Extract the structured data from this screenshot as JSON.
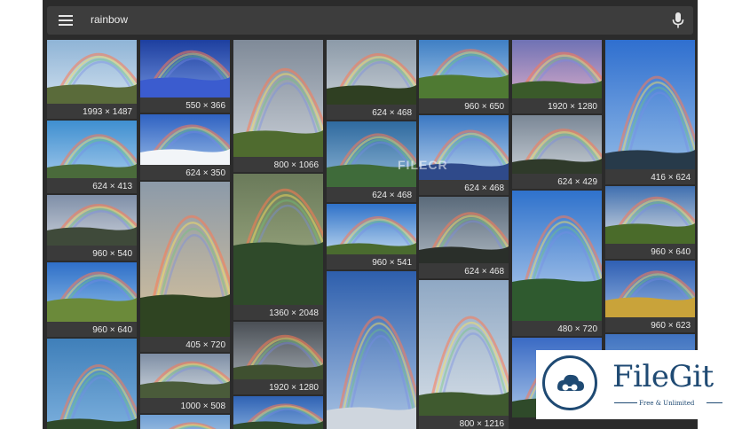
{
  "search": {
    "query": "rainbow"
  },
  "icons": {
    "menu": "hamburger-menu-icon",
    "mic": "microphone-icon"
  },
  "watermark": "FILECR",
  "badge": {
    "name": "FileGit",
    "tagline": "Free & Unlimited"
  },
  "columns": [
    [
      {
        "size": "1993 × 1487",
        "h": 89,
        "sky": [
          "#8fb4d6",
          "#cfdfee"
        ],
        "ground": "#5a6b3a",
        "gh": 0.25
      },
      {
        "size": "624 × 413",
        "h": 82,
        "sky": [
          "#3f8fd0",
          "#9fc7ea"
        ],
        "ground": "#4a6b3b",
        "gh": 0.18
      },
      {
        "size": "960 × 540",
        "h": 74,
        "sky": [
          "#7f8fa8",
          "#c9cfd9"
        ],
        "ground": "#3f4a3a",
        "gh": 0.3
      },
      {
        "size": "960 × 640",
        "h": 84,
        "sky": [
          "#2f6fc8",
          "#8fbfe8"
        ],
        "ground": "#6b8a3a",
        "gh": 0.35
      },
      {
        "size": "",
        "h": 110,
        "sky": [
          "#3f7fb9",
          "#7fb2df"
        ],
        "ground": "#2f4a2a",
        "gh": 0.15
      }
    ],
    [
      {
        "size": "550 × 366",
        "h": 82,
        "sky": [
          "#1d3f9f",
          "#6e8fdc"
        ],
        "ground": "#3b5ccf",
        "gh": 0.3
      },
      {
        "size": "624 × 350",
        "h": 74,
        "sky": [
          "#2f62c2",
          "#8fb3e3"
        ],
        "ground": "#f2f5f8",
        "gh": 0.25
      },
      {
        "size": "405 × 720",
        "h": 192,
        "sky": [
          "#8c9aa9",
          "#d8c29b"
        ],
        "ground": "#2f4422",
        "gh": 0.25
      },
      {
        "size": "1000 × 508",
        "h": 67,
        "sky": [
          "#7e8ea4",
          "#d0d8e0"
        ],
        "ground": "#4a5b3a",
        "gh": 0.3
      },
      {
        "size": "",
        "h": 40,
        "sky": [
          "#6f9fd4",
          "#bcd2ea"
        ],
        "ground": "#dfe6ee",
        "gh": 0.2
      }
    ],
    [
      {
        "size": "800 × 1066",
        "h": 149,
        "sky": [
          "#7f8a98",
          "#c8ced6"
        ],
        "ground": "#4f6b2f",
        "gh": 0.2
      },
      {
        "size": "1360 × 2048",
        "h": 165,
        "sky": [
          "#6a7a5a",
          "#a8b48a"
        ],
        "ground": "#2f4a2a",
        "gh": 0.45
      },
      {
        "size": "1920 × 1280",
        "h": 82,
        "sky": [
          "#4a4f55",
          "#9aa1a8"
        ],
        "ground": "#3f5030",
        "gh": 0.2
      },
      {
        "size": "",
        "h": 40,
        "sky": [
          "#2f62b4",
          "#7fa8da"
        ],
        "ground": "#304a2a",
        "gh": 0.2
      }
    ],
    [
      {
        "size": "624 × 468",
        "h": 90,
        "sky": [
          "#8c9aa8",
          "#c4ccd4"
        ],
        "ground": "#2f3f22",
        "gh": 0.25
      },
      {
        "size": "624 × 468",
        "h": 91,
        "sky": [
          "#2f6a9f",
          "#8fb6d6"
        ],
        "ground": "#3f6b3a",
        "gh": 0.3
      },
      {
        "size": "960 × 541",
        "h": 74,
        "sky": [
          "#2f72c9",
          "#bcd6ee"
        ],
        "ground": "#4a6b2f",
        "gh": 0.15
      },
      {
        "size": "",
        "h": 178,
        "sky": [
          "#2e5fad",
          "#a9c3e3"
        ],
        "ground": "#cfd6de",
        "gh": 0.12
      }
    ],
    [
      {
        "size": "960 × 650",
        "h": 83,
        "sky": [
          "#3f7fc4",
          "#a7c8e8"
        ],
        "ground": "#4f7a33",
        "gh": 0.35
      },
      {
        "size": "624 × 468",
        "h": 90,
        "sky": [
          "#3b78c3",
          "#b8d2ec"
        ],
        "ground": "#2f4a8a",
        "gh": 0.2
      },
      {
        "size": "624 × 468",
        "h": 92,
        "sky": [
          "#5a6a7a",
          "#aab4be"
        ],
        "ground": "#2a2f2a",
        "gh": 0.2
      },
      {
        "size": "800 × 1216",
        "h": 170,
        "sky": [
          "#8fa8c4",
          "#d4dde6"
        ],
        "ground": "#3f5a2f",
        "gh": 0.15
      }
    ],
    [
      {
        "size": "1920 × 1280",
        "h": 83,
        "sky": [
          "#6f72b4",
          "#d2a8c8"
        ],
        "ground": "#3a5a2a",
        "gh": 0.25
      },
      {
        "size": "624 × 429",
        "h": 83,
        "sky": [
          "#7a8796",
          "#c5ccd3"
        ],
        "ground": "#2f3a2a",
        "gh": 0.2
      },
      {
        "size": "480 × 720",
        "h": 164,
        "sky": [
          "#2f72cc",
          "#bcd3ee"
        ],
        "ground": "#2f5a2f",
        "gh": 0.3
      },
      {
        "size": "",
        "h": 90,
        "sky": [
          "#3a6ac4",
          "#a8c4e8"
        ],
        "ground": "#2f4a2a",
        "gh": 0.2
      }
    ],
    [
      {
        "size": "416 × 624",
        "h": 163,
        "sky": [
          "#2f6fcf",
          "#8fb8e6"
        ],
        "ground": "#273a4a",
        "gh": 0.12
      },
      {
        "size": "960 × 640",
        "h": 82,
        "sky": [
          "#3f6fb0",
          "#d8dde2"
        ],
        "ground": "#4a6b2a",
        "gh": 0.3
      },
      {
        "size": "960 × 623",
        "h": 81,
        "sky": [
          "#2f5fb4",
          "#8fb0dc"
        ],
        "ground": "#c9a33a",
        "gh": 0.3
      },
      {
        "size": "",
        "h": 90,
        "sky": [
          "#3f72c0",
          "#9ec0e4"
        ],
        "ground": "#2f4a2a",
        "gh": 0.2
      }
    ]
  ]
}
